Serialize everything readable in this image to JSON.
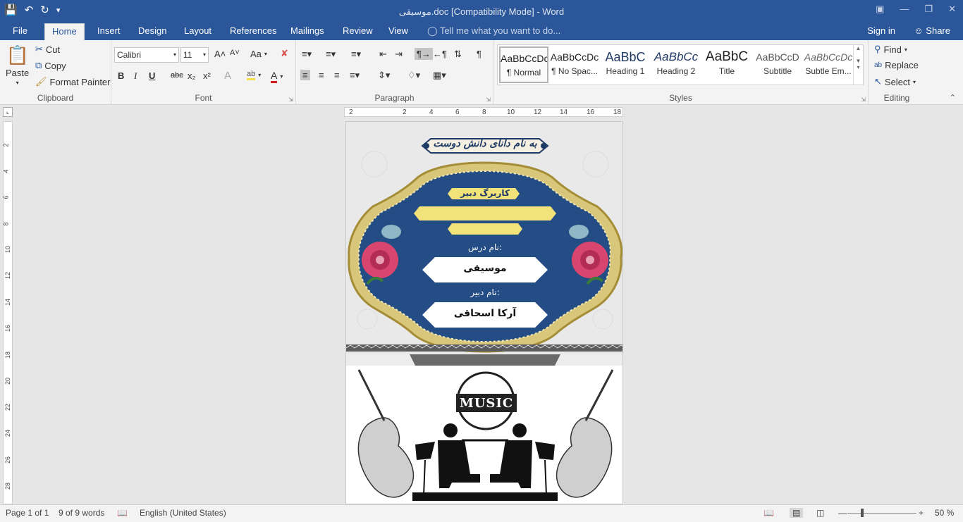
{
  "window": {
    "title": "موسیقی.doc [Compatibility Mode] - Word"
  },
  "tabs": [
    "File",
    "Home",
    "Insert",
    "Design",
    "Layout",
    "References",
    "Mailings",
    "Review",
    "View"
  ],
  "tell_me": "Tell me what you want to do...",
  "account": {
    "sign_in": "Sign in",
    "share": "Share"
  },
  "clipboard": {
    "paste": "Paste",
    "cut": "Cut",
    "copy": "Copy",
    "format_painter": "Format Painter",
    "label": "Clipboard"
  },
  "font": {
    "name": "Calibri",
    "size": "11",
    "label": "Font",
    "bold": "B",
    "italic": "I",
    "underline": "U",
    "strike": "abc",
    "sub": "x₂",
    "sup": "x²",
    "case": "Aa"
  },
  "paragraph": {
    "label": "Paragraph"
  },
  "styles": {
    "label": "Styles",
    "items": [
      {
        "preview": "AaBbCcDc",
        "name": "¶ Normal"
      },
      {
        "preview": "AaBbCcDc",
        "name": "¶ No Spac..."
      },
      {
        "preview": "AaBbC",
        "name": "Heading 1"
      },
      {
        "preview": "AaBbCc",
        "name": "Heading 2"
      },
      {
        "preview": "AaBbC",
        "name": "Title"
      },
      {
        "preview": "AaBbCcD",
        "name": "Subtitle"
      },
      {
        "preview": "AaBbCcDc",
        "name": "Subtle Em..."
      }
    ]
  },
  "editing": {
    "find": "Find",
    "replace": "Replace",
    "select": "Select",
    "label": "Editing"
  },
  "ruler": {
    "h": [
      "2",
      "2",
      "4",
      "6",
      "8",
      "10",
      "12",
      "14",
      "16",
      "18"
    ],
    "v": [
      "2",
      "4",
      "6",
      "8",
      "10",
      "12",
      "14",
      "16",
      "18",
      "20",
      "22",
      "24",
      "26",
      "28"
    ]
  },
  "document": {
    "header_calligraphy": "به نام دانای دانش دوست",
    "banner": "کاربرگ دبیر",
    "lesson_label": "نام درس:",
    "lesson_value": "موسیقی",
    "teacher_label": "نام دبیر:",
    "teacher_value": "آرکا اسحاقی",
    "music_logo": "MUSIC"
  },
  "status": {
    "page": "Page 1 of 1",
    "words": "9 of 9 words",
    "language": "English (United States)",
    "zoom": "50 %"
  },
  "colors": {
    "accent": "#2b579a",
    "frame_gold": "#c9b25a",
    "inner_blue": "#234d84",
    "banner_yellow": "#f2e27a"
  }
}
